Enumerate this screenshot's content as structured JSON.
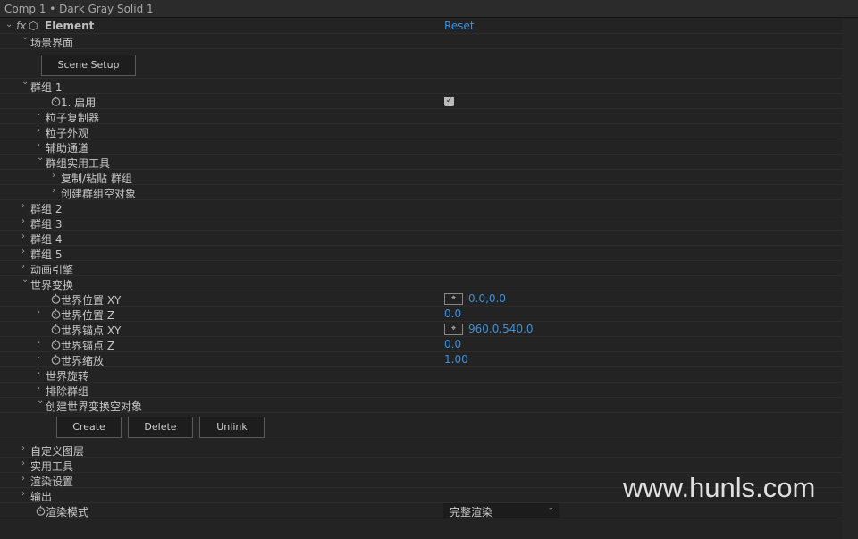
{
  "title": "Comp 1 • Dark Gray Solid 1",
  "effect": {
    "name": "Element",
    "reset_label": "Reset"
  },
  "rows": [
    {
      "label": "场景界面",
      "level": 1,
      "twirl": "open"
    },
    {
      "type": "buttons",
      "buttons": [
        "Scene Setup"
      ],
      "indent": 46
    },
    {
      "label": "群组 1",
      "level": 1,
      "twirl": "open"
    },
    {
      "label": "1. 启用",
      "level": 2,
      "stopwatch": true,
      "checkbox": true
    },
    {
      "label": "粒子复制器",
      "level": 2,
      "twirl": "closed"
    },
    {
      "label": "粒子外观",
      "level": 2,
      "twirl": "closed"
    },
    {
      "label": "辅助通道",
      "level": 2,
      "twirl": "closed"
    },
    {
      "label": "群组实用工具",
      "level": 2,
      "twirl": "open"
    },
    {
      "label": "复制/粘贴 群组",
      "level": 3,
      "twirl": "closed"
    },
    {
      "label": "创建群组空对象",
      "level": 3,
      "twirl": "closed"
    },
    {
      "label": "群组 2",
      "level": 1,
      "twirl": "closed"
    },
    {
      "label": "群组 3",
      "level": 1,
      "twirl": "closed"
    },
    {
      "label": "群组 4",
      "level": 1,
      "twirl": "closed"
    },
    {
      "label": "群组 5",
      "level": 1,
      "twirl": "closed"
    },
    {
      "label": "动画引擎",
      "level": 1,
      "twirl": "closed"
    },
    {
      "label": "世界变换",
      "level": 1,
      "twirl": "open"
    },
    {
      "label": "世界位置 XY",
      "level": 2,
      "stopwatch": true,
      "value": "0.0,0.0",
      "point": true
    },
    {
      "label": "世界位置 Z",
      "level": 2,
      "twirl": "closed",
      "stopwatch": true,
      "value": "0.0"
    },
    {
      "label": "世界锚点 XY",
      "level": 2,
      "stopwatch": true,
      "value": "960.0,540.0",
      "point": true
    },
    {
      "label": "世界锚点 Z",
      "level": 2,
      "twirl": "closed",
      "stopwatch": true,
      "value": "0.0"
    },
    {
      "label": "世界缩放",
      "level": 2,
      "twirl": "closed",
      "stopwatch": true,
      "value": "1.00"
    },
    {
      "label": "世界旋转",
      "level": 2,
      "twirl": "closed"
    },
    {
      "label": "排除群组",
      "level": 2,
      "twirl": "closed"
    },
    {
      "label": "创建世界变换空对象",
      "level": 2,
      "twirl": "open"
    },
    {
      "type": "buttons",
      "buttons": [
        "Create",
        "Delete",
        "Unlink"
      ],
      "indent": 63
    },
    {
      "label": "自定义图层",
      "level": 1,
      "twirl": "closed"
    },
    {
      "label": "实用工具",
      "level": 1,
      "twirl": "closed"
    },
    {
      "label": "渲染设置",
      "level": 1,
      "twirl": "closed"
    },
    {
      "label": "输出",
      "level": 1,
      "twirl": "closed"
    },
    {
      "label": "渲染模式",
      "level": 1,
      "stopwatch": true,
      "dropdown": "完整渲染"
    }
  ],
  "watermark": "www.hunls.com"
}
